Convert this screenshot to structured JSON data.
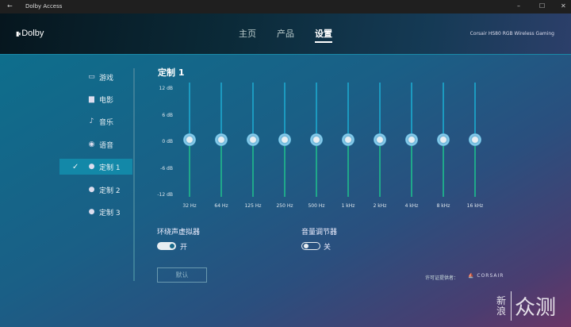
{
  "window": {
    "title": "Dolby Access",
    "minimize": "–",
    "maximize": "☐",
    "close": "✕",
    "back": "←"
  },
  "header": {
    "logo": "Dolby",
    "nav": [
      {
        "label": "主页"
      },
      {
        "label": "产品"
      },
      {
        "label": "设置",
        "active": true
      }
    ],
    "device": "Corsair HS80 RGB Wireless Gaming"
  },
  "sidebar": {
    "items": [
      {
        "label": "游戏",
        "icon": "gamepad-icon",
        "glyph": "▭"
      },
      {
        "label": "电影",
        "icon": "clapperboard-icon",
        "glyph": "▆"
      },
      {
        "label": "音乐",
        "icon": "music-note-icon",
        "glyph": "♪"
      },
      {
        "label": "语音",
        "icon": "voice-icon",
        "glyph": "◉"
      },
      {
        "label": "定制 1",
        "icon": "person-icon",
        "glyph": "●",
        "selected": true,
        "check": "✓"
      },
      {
        "label": "定制 2",
        "icon": "person-icon",
        "glyph": "●"
      },
      {
        "label": "定制 3",
        "icon": "person-icon",
        "glyph": "●"
      }
    ]
  },
  "eq": {
    "title": "定制 1",
    "db_labels": [
      "12 dB",
      "6 dB",
      "0 dB",
      "-6 dB",
      "-12 dB"
    ],
    "range": [
      -12,
      12
    ],
    "bands": [
      {
        "freq": "32 Hz",
        "value": 0
      },
      {
        "freq": "64 Hz",
        "value": 0
      },
      {
        "freq": "125 Hz",
        "value": 0
      },
      {
        "freq": "250 Hz",
        "value": 0
      },
      {
        "freq": "500 Hz",
        "value": 0
      },
      {
        "freq": "1 kHz",
        "value": 0
      },
      {
        "freq": "2 kHz",
        "value": 0
      },
      {
        "freq": "4 kHz",
        "value": 0
      },
      {
        "freq": "8 kHz",
        "value": 0
      },
      {
        "freq": "16 kHz",
        "value": 0
      }
    ]
  },
  "settings": {
    "surround": {
      "label": "环绕声虚拟器",
      "state": "开",
      "on": true
    },
    "leveler": {
      "label": "音量调节器",
      "state": "关",
      "on": false
    },
    "default_button": "默认"
  },
  "license": {
    "label": "许可证提供者：",
    "brand": "CORSAIR"
  },
  "watermark": {
    "text1": "新",
    "text2": "浪",
    "text3": "众测"
  },
  "colors": {
    "track_top": "#1c9ac0",
    "track_bottom": "#1fa88a",
    "selected": "#1388a8"
  }
}
